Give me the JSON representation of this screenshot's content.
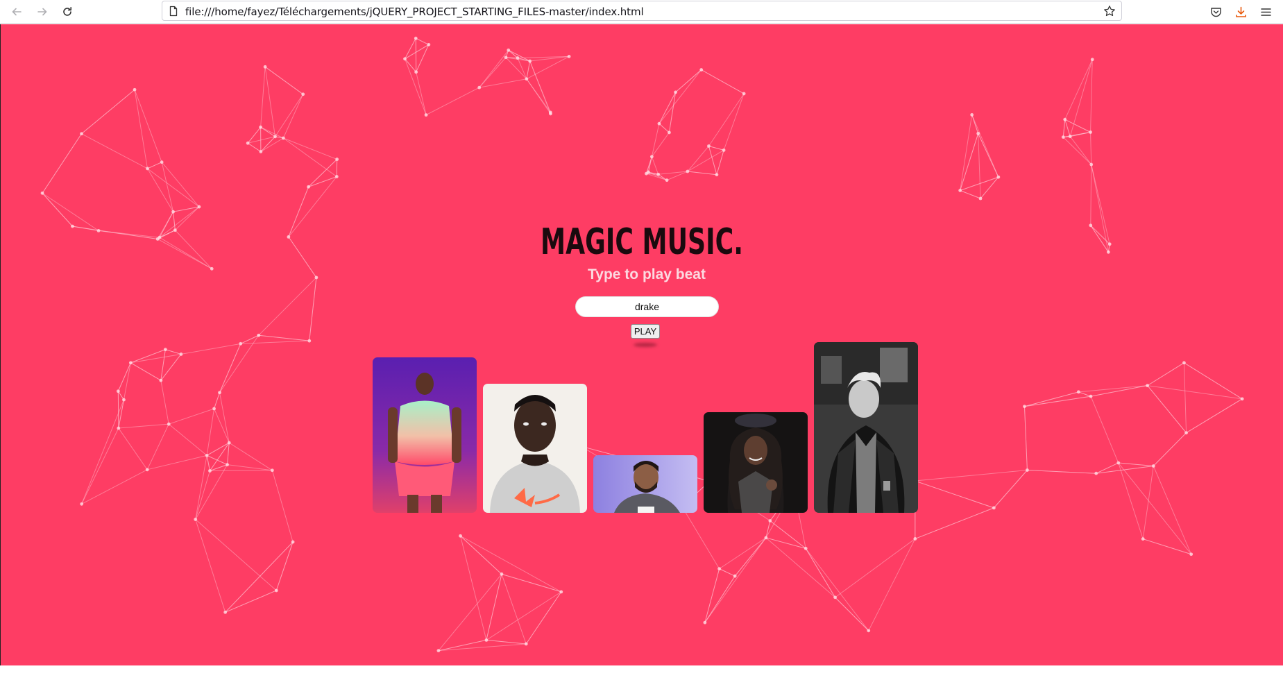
{
  "browser": {
    "url": "file:///home/fayez/Téléchargements/jQUERY_PROJECT_STARTING_FILES-master/index.html",
    "icons": [
      "back-arrow-icon",
      "forward-arrow-icon",
      "reload-icon",
      "page-icon",
      "bookmark-star-icon",
      "pocket-icon",
      "download-icon",
      "menu-icon"
    ]
  },
  "page": {
    "background_color": "#fe3d64",
    "logo_text": "MAGIC MUSIC.",
    "subtitle": "Type to play beat",
    "search_value": "drake",
    "play_label": "PLAY",
    "artists": [
      {
        "name": "artist-card-1",
        "palette": [
          "#6a1fa8",
          "#3f1490",
          "#f2a8a0",
          "#6fe0b8"
        ]
      },
      {
        "name": "artist-card-2",
        "palette": [
          "#f4f1ec",
          "#d9d9d9",
          "#3d2a22",
          "#ff6b4a"
        ]
      },
      {
        "name": "artist-card-drake",
        "palette": [
          "#a59ae8",
          "#7b6fd4",
          "#5a4036",
          "#d7d2f2"
        ]
      },
      {
        "name": "artist-card-4",
        "palette": [
          "#181616",
          "#2c2a2a",
          "#6b5548",
          "#444"
        ]
      },
      {
        "name": "artist-card-5",
        "palette": [
          "#4d4d4d",
          "#1e1e1e",
          "#d4d4d4",
          "#8f8f8f"
        ]
      }
    ]
  }
}
